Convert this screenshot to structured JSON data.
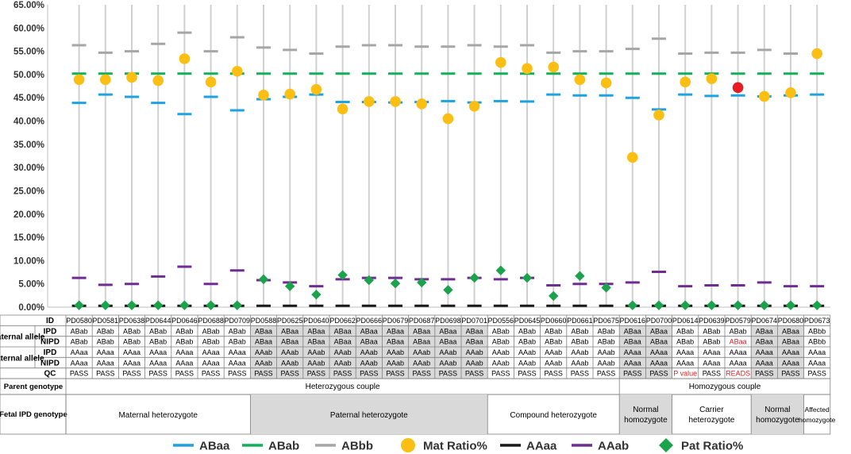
{
  "chart_data": {
    "type": "scatter",
    "y_axis": {
      "ticks": [
        "0.00%",
        "5.00%",
        "10.00%",
        "15.00%",
        "20.00%",
        "25.00%",
        "30.00%",
        "35.00%",
        "40.00%",
        "45.00%",
        "50.00%",
        "55.00%",
        "60.00%",
        "65.00%"
      ],
      "ylim": [
        0,
        65
      ],
      "grid": "vertical"
    },
    "samples": [
      "PD0580",
      "PD0581",
      "PD0638",
      "PD0644",
      "PD0646",
      "PD0688",
      "PD0709",
      "PD0588",
      "PD0625",
      "PD0640",
      "PD0662",
      "PD0666",
      "PD0679",
      "PD0687",
      "PD0698",
      "PD0701",
      "PD0556",
      "PD0645",
      "PD0660",
      "PD0661",
      "PD0675",
      "PD0616",
      "PD0700",
      "PD0614",
      "PD0639",
      "PD0579",
      "PD0674",
      "PD0680",
      "PD0673"
    ],
    "series": [
      {
        "name": "ABaa",
        "marker": "dash",
        "color": "#1ea2e0",
        "values": [
          43.9,
          45.7,
          45.2,
          43.9,
          41.5,
          45.2,
          42.3,
          44.7,
          45.2,
          45.7,
          44.1,
          44.1,
          44.0,
          44.1,
          44.3,
          44.0,
          44.3,
          44.2,
          45.7,
          45.5,
          45.5,
          45.0,
          42.5,
          45.7,
          45.4,
          45.5,
          45.3,
          45.5,
          45.7
        ]
      },
      {
        "name": "ABab",
        "marker": "dash",
        "color": "#13b05a",
        "values": [
          50.2,
          50.2,
          50.2,
          50.2,
          50.2,
          50.2,
          50.2,
          50.2,
          50.2,
          50.2,
          50.2,
          50.2,
          50.2,
          50.2,
          50.2,
          50.2,
          50.2,
          50.2,
          50.2,
          50.2,
          50.2,
          50.2,
          50.2,
          50.2,
          50.2,
          50.2,
          50.2,
          50.2,
          50.2
        ]
      },
      {
        "name": "ABbb",
        "marker": "dash",
        "color": "#a6a6a6",
        "values": [
          56.3,
          54.7,
          55.0,
          56.6,
          59.0,
          55.0,
          58.0,
          55.8,
          55.3,
          54.5,
          56.0,
          56.3,
          56.3,
          56.0,
          56.0,
          56.3,
          56.0,
          56.3,
          54.7,
          55.0,
          55.0,
          55.5,
          57.7,
          54.5,
          54.7,
          54.7,
          55.3,
          54.5,
          null
        ]
      },
      {
        "name": "Mat Ratio%",
        "marker": "circle",
        "color": "#fbbf14",
        "values": [
          48.9,
          48.9,
          49.4,
          48.7,
          53.4,
          48.4,
          50.7,
          45.6,
          45.8,
          46.8,
          42.6,
          44.2,
          44.2,
          43.7,
          40.5,
          43.2,
          52.6,
          51.3,
          51.6,
          48.9,
          48.2,
          32.2,
          41.3,
          48.4,
          49.1,
          47.2,
          45.3,
          46.1,
          54.5
        ],
        "highlight": {
          "index": 25,
          "color": "#e71b22"
        }
      },
      {
        "name": "AAaa",
        "marker": "dash",
        "color": "#1a1a1a",
        "values": [
          0.3,
          0.3,
          0.3,
          0.3,
          0.3,
          0.3,
          0.3,
          0.3,
          0.3,
          0.3,
          0.3,
          0.3,
          0.3,
          0.3,
          0.3,
          0.3,
          0.3,
          0.3,
          0.3,
          0.3,
          0.3,
          0.3,
          0.3,
          0.3,
          0.3,
          0.3,
          0.3,
          0.3,
          0.3
        ]
      },
      {
        "name": "AAab",
        "marker": "dash",
        "color": "#6f2c91",
        "values": [
          6.3,
          4.8,
          5.0,
          6.6,
          8.7,
          5.0,
          7.9,
          5.8,
          5.3,
          4.5,
          6.0,
          6.3,
          6.3,
          6.0,
          6.0,
          6.3,
          6.0,
          6.3,
          4.7,
          5.0,
          5.0,
          5.3,
          7.6,
          4.5,
          4.7,
          4.7,
          5.3,
          4.5,
          4.5
        ]
      },
      {
        "name": "Pat Ratio%",
        "marker": "diamond",
        "color": "#1aa34a",
        "values": [
          0.4,
          0.4,
          0.4,
          0.4,
          0.4,
          0.4,
          0.4,
          6.0,
          4.5,
          2.7,
          6.9,
          5.8,
          5.1,
          5.3,
          3.7,
          6.3,
          7.9,
          6.3,
          2.4,
          6.7,
          4.2,
          0.4,
          0.4,
          0.4,
          0.4,
          0.4,
          0.4,
          0.4,
          0.4
        ]
      }
    ]
  },
  "table": {
    "row_labels": {
      "id": "ID",
      "maternal_group": "Maternal allele",
      "paternal_group": "Paternal allele",
      "ipd": "IPD",
      "nipd": "NIPD",
      "qc": "QC",
      "parent_genotype": "Parent genotype",
      "fetal_ipd_genotype": "Fetal IPD genotype"
    },
    "maternal_ipd": [
      "ABab",
      "ABab",
      "ABab",
      "ABab",
      "ABab",
      "ABab",
      "ABab",
      "ABaa",
      "ABaa",
      "ABaa",
      "ABaa",
      "ABaa",
      "ABaa",
      "ABaa",
      "ABaa",
      "ABaa",
      "ABab",
      "ABab",
      "ABab",
      "ABab",
      "ABab",
      "ABaa",
      "ABaa",
      "ABab",
      "ABab",
      "ABab",
      "ABaa",
      "ABaa",
      "ABbb"
    ],
    "maternal_nipd": [
      "ABab",
      "ABab",
      "ABab",
      "ABab",
      "ABab",
      "ABab",
      "ABab",
      "ABaa",
      "ABaa",
      "ABaa",
      "ABaa",
      "ABaa",
      "ABaa",
      "ABaa",
      "ABaa",
      "ABaa",
      "ABab",
      "ABab",
      "ABab",
      "ABab",
      "ABab",
      "ABaa",
      "ABaa",
      "ABab",
      "ABab",
      "ABaa",
      "ABaa",
      "ABaa",
      "ABbb"
    ],
    "paternal_ipd": [
      "AAaa",
      "AAaa",
      "AAaa",
      "AAaa",
      "AAaa",
      "AAaa",
      "AAaa",
      "AAab",
      "AAab",
      "AAab",
      "AAab",
      "AAab",
      "AAab",
      "AAab",
      "AAab",
      "AAab",
      "AAab",
      "AAab",
      "AAab",
      "AAab",
      "AAab",
      "AAaa",
      "AAaa",
      "AAaa",
      "AAaa",
      "AAaa",
      "AAaa",
      "AAaa",
      "AAaa"
    ],
    "paternal_nipd": [
      "AAaa",
      "AAaa",
      "AAaa",
      "AAaa",
      "AAaa",
      "AAaa",
      "AAaa",
      "AAab",
      "AAab",
      "AAab",
      "AAab",
      "AAab",
      "AAab",
      "AAab",
      "AAab",
      "AAab",
      "AAab",
      "AAab",
      "AAab",
      "AAab",
      "AAab",
      "AAaa",
      "AAaa",
      "AAaa",
      "AAaa",
      "AAaa",
      "AAaa",
      "AAaa",
      "AAaa"
    ],
    "qc": [
      "PASS",
      "PASS",
      "PASS",
      "PASS",
      "PASS",
      "PASS",
      "PASS",
      "PASS",
      "PASS",
      "PASS",
      "PASS",
      "PASS",
      "PASS",
      "PASS",
      "PASS",
      "PASS",
      "PASS",
      "PASS",
      "PASS",
      "PASS",
      "PASS",
      "PASS",
      "PASS",
      "P value",
      "PASS",
      "READS",
      "PASS",
      "PASS",
      "PASS"
    ],
    "red_cells": {
      "maternal_nipd": [
        25
      ],
      "qc": [
        23,
        25
      ]
    },
    "parent_genotype_groups": [
      {
        "label": "Heterozygous couple",
        "span": 21
      },
      {
        "label": "Homozygous couple",
        "span": 8
      }
    ],
    "fetal_groups": [
      {
        "label": "Maternal heterozygote",
        "span": 7,
        "shaded": false
      },
      {
        "label": "Paternal heterozygote",
        "span": 9,
        "shaded": true
      },
      {
        "label": "Compound heterozygote",
        "span": 5,
        "shaded": false
      },
      {
        "label": "Normal homozygote",
        "span": 2,
        "shaded": true
      },
      {
        "label": "Carrier heterozygote",
        "span": 3,
        "shaded": false
      },
      {
        "label": "Normal homozygote",
        "span": 2,
        "shaded": true
      },
      {
        "label": "Affected homozygote",
        "span": 1,
        "shaded": false
      }
    ],
    "shaded_columns": [
      7,
      8,
      9,
      10,
      11,
      12,
      13,
      14,
      15,
      21,
      22,
      26,
      27
    ],
    "colors": {
      "shade": "#d9d9d9",
      "red_text": "#e71b22",
      "border": "#7f7f7f"
    }
  },
  "legend": {
    "placement": "bottom",
    "items": [
      "ABaa",
      "ABab",
      "ABbb",
      "Mat Ratio%",
      "AAaa",
      "AAab",
      "Pat Ratio%"
    ]
  }
}
